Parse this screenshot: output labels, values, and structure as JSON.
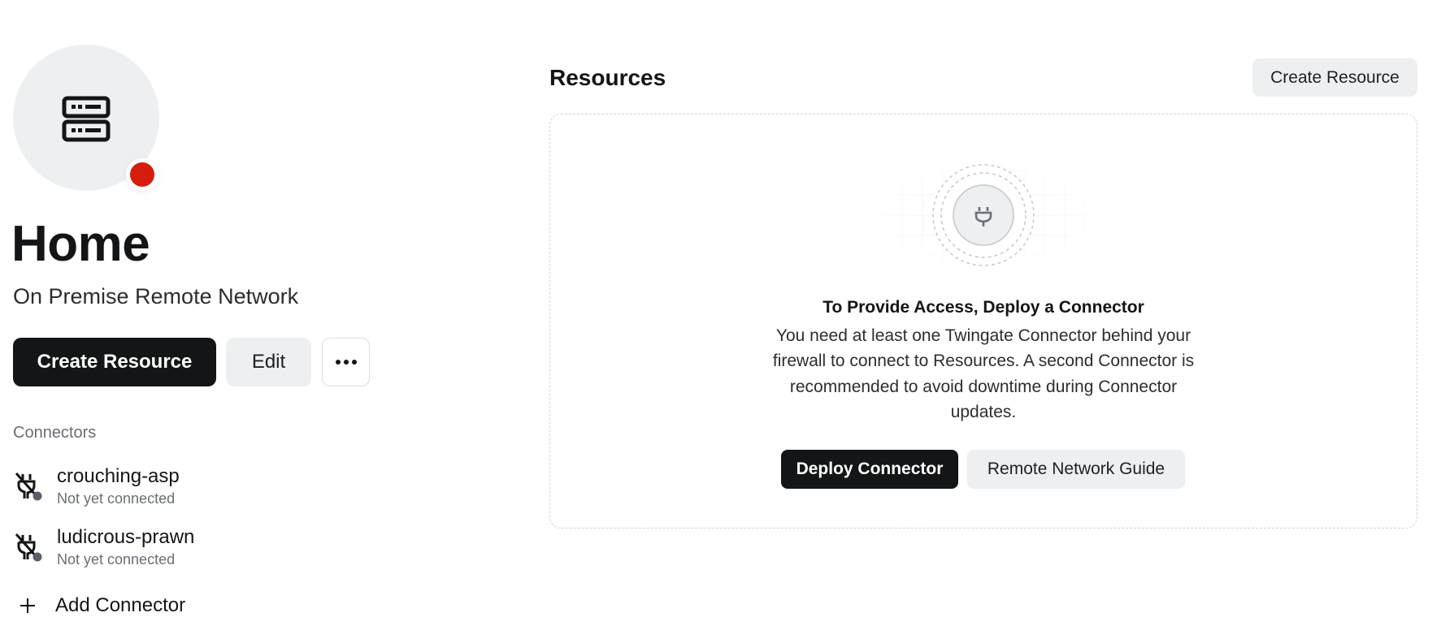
{
  "network": {
    "icon": "server-icon",
    "status_color": "#d41d0d",
    "name": "Home",
    "type": "On Premise Remote Network"
  },
  "actions": {
    "create_resource": "Create Resource",
    "edit": "Edit",
    "more_icon": "more-horizontal-icon"
  },
  "connectors": {
    "label": "Connectors",
    "items": [
      {
        "name": "crouching-asp",
        "status": "Not yet connected",
        "icon": "plug-disconnected-icon"
      },
      {
        "name": "ludicrous-prawn",
        "status": "Not yet connected",
        "icon": "plug-disconnected-icon"
      }
    ],
    "add_label": "Add Connector",
    "add_icon": "plus-icon"
  },
  "resources": {
    "heading": "Resources",
    "create_label": "Create Resource",
    "empty_state": {
      "icon": "plug-icon",
      "title": "To Provide Access, Deploy a Connector",
      "body": "You need at least one Twingate Connector behind your firewall to connect to Resources. A second Connector is recommended to avoid downtime during Connector updates.",
      "primary_label": "Deploy Connector",
      "secondary_label": "Remote Network Guide"
    }
  },
  "colors": {
    "primary": "#141517",
    "secondary_bg": "#eeeff1",
    "muted_text": "#6b6e75",
    "offline": "#d41d0d"
  }
}
